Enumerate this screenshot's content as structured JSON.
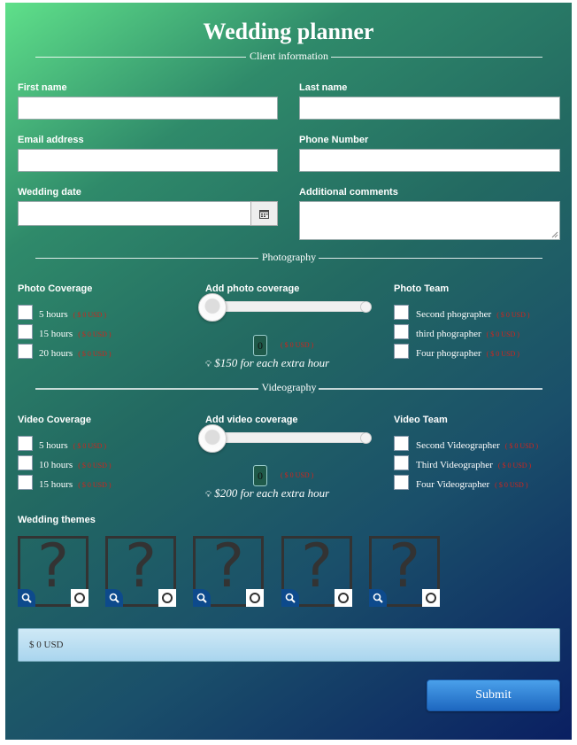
{
  "title": "Wedding planner",
  "sections": {
    "client": "Client information",
    "photography": "Photography",
    "videography": "Videography"
  },
  "client": {
    "first_name_label": "First name",
    "last_name_label": "Last name",
    "email_label": "Email address",
    "phone_label": "Phone Number",
    "date_label": "Wedding date",
    "comments_label": "Additional comments",
    "calendar_icon": "calendar-icon"
  },
  "photo": {
    "coverage_label": "Photo Coverage",
    "options": [
      {
        "label": "5 hours",
        "price": "( $ 0 USD )"
      },
      {
        "label": "15 hours",
        "price": "( $ 0 USD )"
      },
      {
        "label": "20 hours",
        "price": "( $ 0 USD )"
      }
    ],
    "add_label": "Add photo coverage",
    "counter": "0",
    "counter_price": "( $ 0 USD )",
    "note": "$150 for each extra hour",
    "team_label": "Photo Team",
    "team": [
      {
        "label": "Second phographer",
        "price": "( $ 0 USD )"
      },
      {
        "label": "third phographer",
        "price": "( $ 0 USD )"
      },
      {
        "label": "Four phographer",
        "price": "( $ 0 USD )"
      }
    ]
  },
  "video": {
    "coverage_label": "Video Coverage",
    "options": [
      {
        "label": "5 hours",
        "price": "( $ 0 USD )"
      },
      {
        "label": "10 hours",
        "price": "( $ 0 USD )"
      },
      {
        "label": "15 hours",
        "price": "( $ 0 USD )"
      }
    ],
    "add_label": "Add video coverage",
    "counter": "0",
    "counter_price": "( $ 0 USD )",
    "note": "$200 for each extra hour",
    "team_label": "Video Team",
    "team": [
      {
        "label": "Second Videographer",
        "price": "( $ 0 USD )"
      },
      {
        "label": "Third Videographer",
        "price": "( $ 0 USD )"
      },
      {
        "label": "Four Videographer",
        "price": "( $ 0 USD )"
      }
    ]
  },
  "themes": {
    "label": "Wedding themes",
    "placeholder_glyph": "?",
    "items": [
      "theme-1",
      "theme-2",
      "theme-3",
      "theme-4",
      "theme-5"
    ]
  },
  "total": "$ 0 USD",
  "submit_label": "Submit"
}
